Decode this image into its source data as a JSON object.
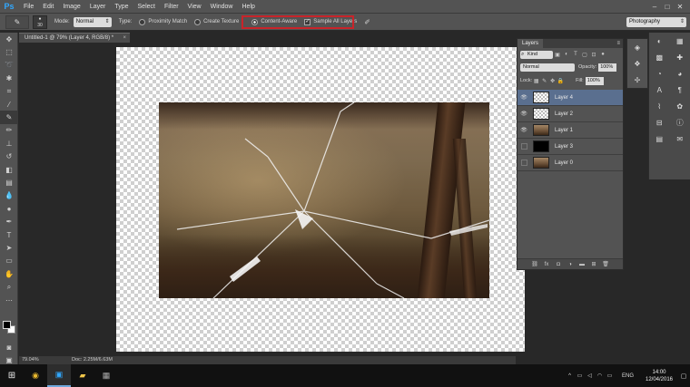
{
  "app": {
    "logo": "Ps",
    "menu": [
      "File",
      "Edit",
      "Image",
      "Layer",
      "Type",
      "Select",
      "Filter",
      "View",
      "Window",
      "Help"
    ],
    "window_controls": [
      "–",
      "□",
      "✕"
    ]
  },
  "options_bar": {
    "tool_icon": "spot-healing-brush-icon",
    "brush_size": "30",
    "mode_label": "Mode:",
    "mode_value": "Normal",
    "type_label": "Type:",
    "type_options": [
      {
        "label": "Proximity Match",
        "selected": false
      },
      {
        "label": "Create Texture",
        "selected": false
      },
      {
        "label": "Content-Aware",
        "selected": true
      }
    ],
    "sample_all_layers_label": "Sample All Layers",
    "sample_all_layers_checked": true,
    "workspace": "Photography",
    "highlight_color": "#c8242a"
  },
  "document": {
    "tab_title": "Untitled-1 @ 79% (Layer 4, RGB/8) *",
    "zoom": "79.04%",
    "doc_size": "Doc: 2.25M/6.63M"
  },
  "layers_panel": {
    "title": "Layers",
    "filter_kind": "Kind",
    "blend_mode": "Normal",
    "opacity_label": "Opacity:",
    "opacity_value": "100%",
    "lock_label": "Lock:",
    "fill_label": "Fill:",
    "fill_value": "100%",
    "layers": [
      {
        "name": "Layer 4",
        "visible": true,
        "selected": true,
        "thumb": "transparent"
      },
      {
        "name": "Layer 2",
        "visible": true,
        "selected": false,
        "thumb": "transparent"
      },
      {
        "name": "Layer 1",
        "visible": true,
        "selected": false,
        "thumb": "photo"
      },
      {
        "name": "Layer 3",
        "visible": false,
        "selected": false,
        "thumb": "black"
      },
      {
        "name": "Layer 0",
        "visible": false,
        "selected": false,
        "thumb": "photo"
      }
    ],
    "accent": "#5a6f8f"
  },
  "taskbar": {
    "language": "ENG",
    "time": "14:00",
    "date": "12/04/2016"
  }
}
